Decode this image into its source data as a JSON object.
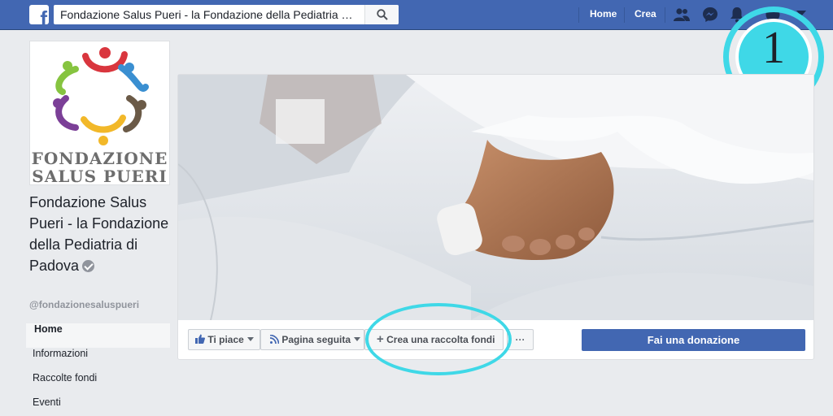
{
  "topbar": {
    "logo_letter": "f",
    "search_value": "Fondazione Salus Pueri - la Fondazione della Pediatria di P...",
    "nav": {
      "home": "Home",
      "create": "Crea"
    },
    "icons": [
      "friends-icon",
      "messenger-icon",
      "notifications-icon",
      "help-icon",
      "account-menu-icon"
    ]
  },
  "badge": {
    "number": "1"
  },
  "profile": {
    "logo_line1": "FONDAZIONE",
    "logo_line2": "SALUS PUERI",
    "name": "Fondazione Salus Pueri - la Fondazione della Pediatria di Padova",
    "handle": "@fondazionesaluspueri"
  },
  "sidebar": {
    "items": [
      {
        "label": "Home",
        "active": true
      },
      {
        "label": "Informazioni",
        "active": false
      },
      {
        "label": "Raccolte fondi",
        "active": false
      },
      {
        "label": "Eventi",
        "active": false
      }
    ]
  },
  "actions": {
    "like": "Ti piace",
    "following": "Pagina seguita",
    "fundraiser": "Crea una raccolta fondi",
    "more": "···",
    "donate": "Fai una donazione"
  },
  "colors": {
    "brand": "#4267b2",
    "highlight": "#3fd8e7",
    "background": "#e9ebee"
  }
}
